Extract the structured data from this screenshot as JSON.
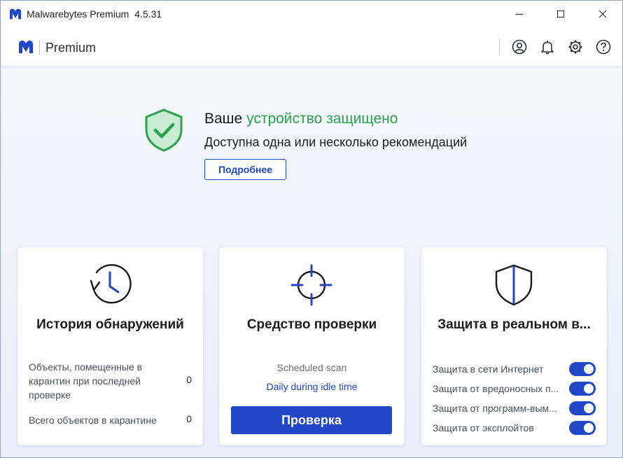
{
  "window": {
    "app_name": "Malwarebytes Premium",
    "version": "4.5.31",
    "controls": [
      "minimize-icon",
      "maximize-icon",
      "close-icon"
    ]
  },
  "header": {
    "brand": "Premium",
    "icons": [
      "account-icon",
      "bell-icon",
      "gear-icon",
      "help-icon"
    ]
  },
  "status": {
    "title_prefix": "Ваше",
    "title_highlight": "устройство защищено",
    "subtitle": "Доступна одна или несколько рекомендаций",
    "details_button": "Подробнее",
    "icon": "shield-check-icon"
  },
  "cards": {
    "history": {
      "title": "История обнаружений",
      "icon": "clock-icon",
      "rows": [
        {
          "label": "Объекты, помещенные в карантин при последней проверке",
          "value": "0"
        },
        {
          "label": "Всего объектов в карантине",
          "value": "0"
        }
      ]
    },
    "scanner": {
      "title": "Средство проверки",
      "icon": "crosshair-icon",
      "schedule_label": "Scheduled scan",
      "schedule_value": "Daily during idle time",
      "scan_button": "Проверка"
    },
    "realtime": {
      "title": "Защита в реальном в...",
      "icon": "shield-icon",
      "items": [
        {
          "label": "Защита в сети Интернет",
          "enabled": true
        },
        {
          "label": "Защита от вредоносных п...",
          "enabled": true
        },
        {
          "label": "Защита от программ-вым...",
          "enabled": true
        },
        {
          "label": "Защита от эксплойтов",
          "enabled": true
        }
      ]
    }
  },
  "colors": {
    "accent": "#1f47c7",
    "success": "#2aa24a",
    "shield_fill": "#c9ecd3"
  }
}
